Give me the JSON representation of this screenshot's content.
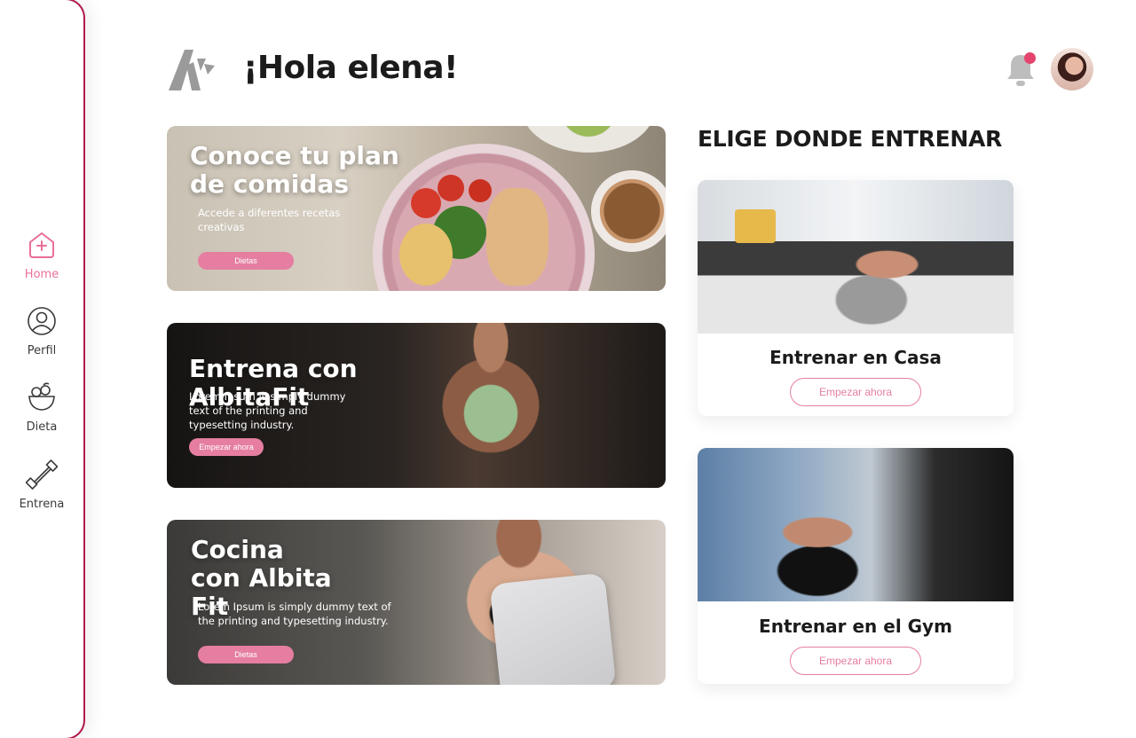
{
  "sidebar": {
    "items": [
      {
        "label": "Home",
        "icon": "home-plus-icon",
        "active": true
      },
      {
        "label": "Perfil",
        "icon": "user-circle-icon",
        "active": false
      },
      {
        "label": "Dieta",
        "icon": "food-bowl-icon",
        "active": false
      },
      {
        "label": "Entrena",
        "icon": "dumbbell-icon",
        "active": false
      }
    ],
    "border_color": "#b0194a",
    "active_color": "#e96f9a"
  },
  "header": {
    "greeting": "¡Hola elena!",
    "notification_icon": "bell-icon",
    "has_notification": true
  },
  "banners": [
    {
      "title": "Conoce tu plan de comidas",
      "description": "Accede a diferentes recetas creativas",
      "button": "Dietas"
    },
    {
      "title": "Entrena con AlbitaFit",
      "description": "Lorem Ipsum is simply dummy text of the printing and typesetting industry.",
      "button": "Empezar ahora"
    },
    {
      "title": "Cocina con Albita Fit",
      "description": "Lorem Ipsum is simply dummy text of the printing and typesetting industry.",
      "button": "Dietas"
    }
  ],
  "training": {
    "section_title": "ELIGE DONDE ENTRENAR",
    "cards": [
      {
        "title": "Entrenar en Casa",
        "button": "Empezar ahora"
      },
      {
        "title": "Entrenar en el Gym",
        "button": "Empezar ahora"
      }
    ]
  },
  "colors": {
    "accent": "#e57ea0",
    "notification_dot": "#e4446e"
  }
}
